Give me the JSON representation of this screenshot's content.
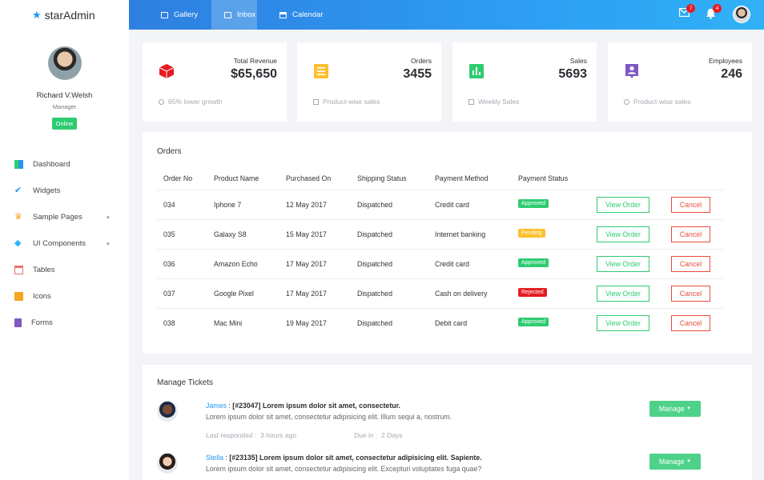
{
  "brand": {
    "name": "starAdmin"
  },
  "profile": {
    "name": "Richard V.Welsh",
    "role": "Manager",
    "status": "Online"
  },
  "sidebar": {
    "items": [
      {
        "label": "Dashboard",
        "icon": "dashboard-icon",
        "caret": ""
      },
      {
        "label": "Widgets",
        "icon": "widgets-icon",
        "caret": ""
      },
      {
        "label": "Sample Pages",
        "icon": "crown-icon",
        "caret": "▾"
      },
      {
        "label": "UI Components",
        "icon": "diamond-icon",
        "caret": "▾"
      },
      {
        "label": "Tables",
        "icon": "calendar-icon",
        "caret": ""
      },
      {
        "label": "Icons",
        "icon": "gift-icon",
        "caret": ""
      },
      {
        "label": "Forms",
        "icon": "form-icon",
        "caret": ""
      }
    ]
  },
  "topbar": {
    "tabs": [
      {
        "label": "Gallery",
        "icon": "image-icon"
      },
      {
        "label": "Inbox",
        "icon": "mail-icon"
      },
      {
        "label": "Calendar",
        "icon": "calendar-icon"
      }
    ],
    "mail_count": "7",
    "bell_count": "4"
  },
  "stats": [
    {
      "label": "Total Revenue",
      "value": "$65,650",
      "foot": "65% lower growth",
      "color": "#e51c23",
      "icon": "cube-icon"
    },
    {
      "label": "Orders",
      "value": "3455",
      "foot": "Product-wise sales",
      "color": "#fbc02d",
      "icon": "receipt-icon"
    },
    {
      "label": "Sales",
      "value": "5693",
      "foot": "Weekly Sales",
      "color": "#2ecc71",
      "icon": "poll-icon"
    },
    {
      "label": "Employees",
      "value": "246",
      "foot": "Product-wise sales",
      "color": "#7e57c2",
      "icon": "account-box-icon"
    }
  ],
  "orders": {
    "title": "Orders",
    "headers": [
      "Order No",
      "Product Name",
      "Purchased On",
      "Shipping Status",
      "Payment Method",
      "Payment Status"
    ],
    "view_label": "View Order",
    "cancel_label": "Cancel",
    "rows": [
      {
        "no": "034",
        "product": "Iphone 7",
        "date": "12 May 2017",
        "shipping": "Dispatched",
        "method": "Credit card",
        "status": "Approved",
        "status_color": "#2ecc71"
      },
      {
        "no": "035",
        "product": "Galaxy S8",
        "date": "15 May 2017",
        "shipping": "Dispatched",
        "method": "Internet banking",
        "status": "Pending",
        "status_color": "#fbc02d"
      },
      {
        "no": "036",
        "product": "Amazon Echo",
        "date": "17 May 2017",
        "shipping": "Dispatched",
        "method": "Credit card",
        "status": "Approved",
        "status_color": "#2ecc71"
      },
      {
        "no": "037",
        "product": "Google Pixel",
        "date": "17 May 2017",
        "shipping": "Dispatched",
        "method": "Cash on delivery",
        "status": "Rejected",
        "status_color": "#e51c23"
      },
      {
        "no": "038",
        "product": "Mac Mini",
        "date": "19 May 2017",
        "shipping": "Dispatched",
        "method": "Debit card",
        "status": "Approved",
        "status_color": "#2ecc71"
      }
    ]
  },
  "tickets": {
    "title": "Manage Tickets",
    "manage_label": "Manage",
    "items": [
      {
        "user": "James",
        "id": "[#23047]",
        "subject": "Lorem ipsum dolor sit amet, consectetur.",
        "body": "Lorem ipsum dolor sit amet, consectetur adipisicing elit. Illum sequi a, nostrum.",
        "last_label": "Last responded :",
        "last_value": "3 hours ago",
        "due_label": "Due in :",
        "due_value": "2 Days"
      },
      {
        "user": "Stella",
        "id": "[#23135]",
        "subject": "Lorem ipsum dolor sit amet, consectetur adipisicing elit. Sapiente.",
        "body": "Lorem ipsum dolor sit amet, consectetur adipisicing elit. Excepturi voluptates fuga quae?",
        "last_label": "",
        "last_value": "",
        "due_label": "",
        "due_value": ""
      }
    ]
  }
}
